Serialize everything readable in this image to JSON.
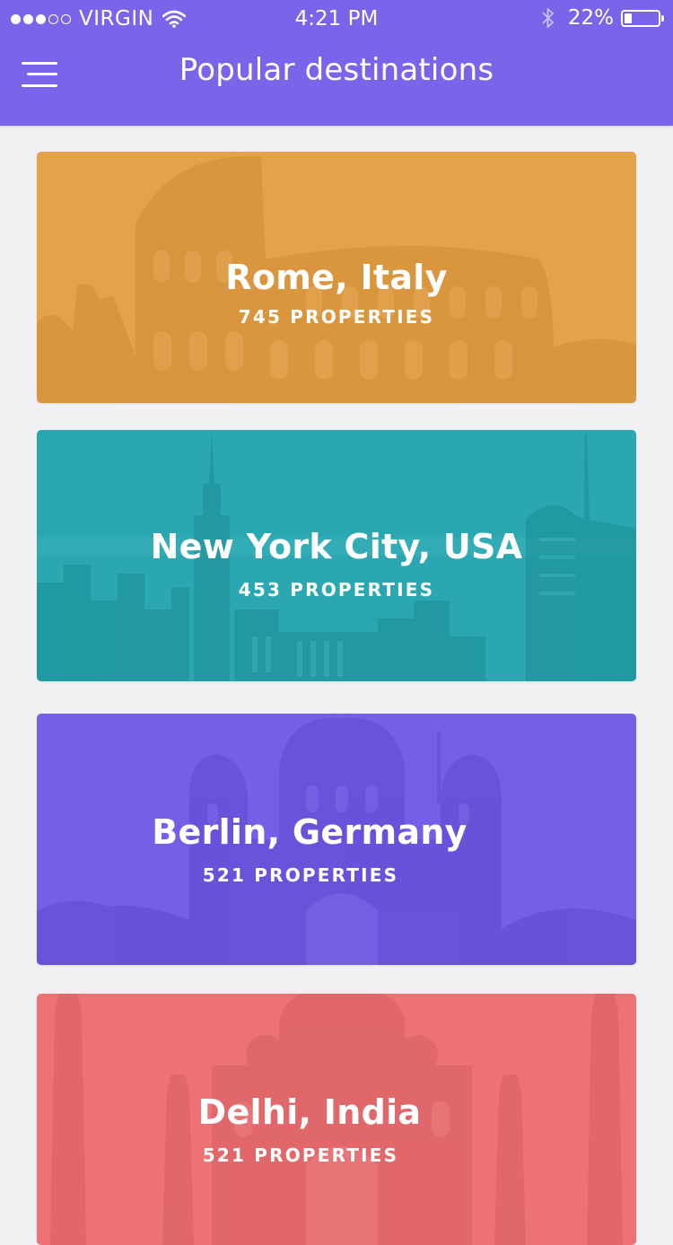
{
  "status_bar": {
    "carrier": "VIRGIN",
    "time": "4:21 PM",
    "battery": "22%",
    "battery_level": 0.22,
    "signal_bars_filled": 3,
    "signal_bars_total": 5,
    "icons": [
      "wifi-icon",
      "bluetooth-icon",
      "battery-icon"
    ]
  },
  "header": {
    "title": "Popular destinations",
    "menu_icon": "hamburger-menu-icon",
    "color": "#7b64ea"
  },
  "destinations": [
    {
      "city": "Rome, Italy",
      "properties": "745 PROPERTIES",
      "color": "#e4a24c",
      "image": "colosseum"
    },
    {
      "city": "New York City, USA",
      "properties": "453 PROPERTIES",
      "color": "#2aa7b0",
      "image": "manhattan-skyline"
    },
    {
      "city": "Berlin, Germany",
      "properties": "521 PROPERTIES",
      "color": "#755fe7",
      "image": "berlin-cathedral"
    },
    {
      "city": "Delhi, India",
      "properties": "521 PROPERTIES",
      "color": "#ec7274",
      "image": "taj-mahal"
    }
  ]
}
